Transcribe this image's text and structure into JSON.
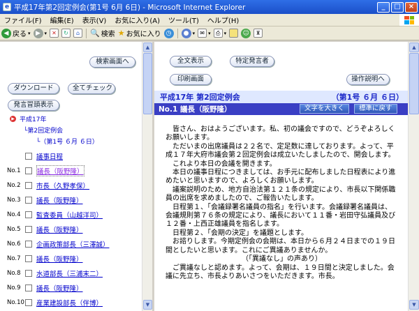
{
  "window": {
    "title": "平成17年第2回定例会(第1号 6月 6日) - Microsoft Internet Explorer",
    "controls": {
      "minimize": "_",
      "maximize": "□",
      "close": "×"
    }
  },
  "menu": [
    "ファイル(F)",
    "編集(E)",
    "表示(V)",
    "お気に入り(A)",
    "ツール(T)",
    "ヘルプ(H)"
  ],
  "toolbar": {
    "back": "戻る",
    "search": "検索",
    "favorites": "お気に入り"
  },
  "left": {
    "search_button": "検索画面へ",
    "download_button": "ダウンロード",
    "check_all_button": "全てチェック",
    "speaker_list_button": "発言冒頭表示",
    "tree": {
      "year": "平成17年",
      "session": "第2回定例会",
      "meeting": "（第1号 ６月 ６日）"
    },
    "schedule": "議事日程",
    "items": [
      {
        "no": "No.1",
        "label": "議長（阪野隆）"
      },
      {
        "no": "No.2",
        "label": "市長（久野孝保）"
      },
      {
        "no": "No.3",
        "label": "議長（阪野隆）"
      },
      {
        "no": "No.4",
        "label": "監査委員（山越洋司）"
      },
      {
        "no": "No.5",
        "label": "議長（阪野隆）"
      },
      {
        "no": "No.6",
        "label": "企画政策部長（三澤誠）"
      },
      {
        "no": "No.7",
        "label": "議長（阪野隆）"
      },
      {
        "no": "No.8",
        "label": "水道部長（三浦末二）"
      },
      {
        "no": "No.9",
        "label": "議長（阪野隆）"
      },
      {
        "no": "No.10",
        "label": "産業建設部長（伴博）"
      }
    ]
  },
  "right": {
    "show_all_button": "全文表示",
    "specific_speaker_button": "特定発言者",
    "print_button": "印刷画面",
    "manual_button": "操作説明へ",
    "header_title": "平成17年 第2回定例会",
    "header_meeting": "（第1号 ６月 ６日）",
    "speaker_line": "No.1 議長（阪野隆）",
    "text_larger_button": "文字を大きく",
    "text_standard_button": "標準に戻す",
    "speech": [
      "皆さん、おはようございます。私、初の議会ですので、どうぞよろしくお願いします。",
      "ただいまの出席議員は２２名で、定足数に達しております。よって、平成１７年大府市議会第２回定例会は成立いたしましたので、開会します。",
      "これより本日の会議を開きます。",
      "本日の議事日程につきましては、お手元に配布しました日程表により進めたいと思いますので、よろしくお願いします。",
      "議案説明のため、地方自治法第１２１条の規定により、市長以下関係職員の出席を求めましたので、ご報告いたします。",
      "日程第１、「会議録署名議員の指名」を行います。会議録署名議員は、会議規則第７６条の規定により、議長において１１番・岩田守弘議員及び１２番・上西正雄議員を指名します。",
      "日程第２、「会期の決定」を議題とします。",
      "お諮りします。今期定例会の会期は、本日から６月２４日までの１９日間としたいと思います。これにご異議ありませんか。",
      "（「異議なし」の声あり）",
      "ご異議なしと認めます。よって、会期は、１９日間と決定しました。会議に先立ち、市長よりあいさつをいただきます。市長。"
    ]
  },
  "colors": {
    "title_bar": "#2f6ee6",
    "header_band": "#dfe8ff",
    "speaker_band": "#3a3fc4",
    "link": "#0000cc"
  }
}
